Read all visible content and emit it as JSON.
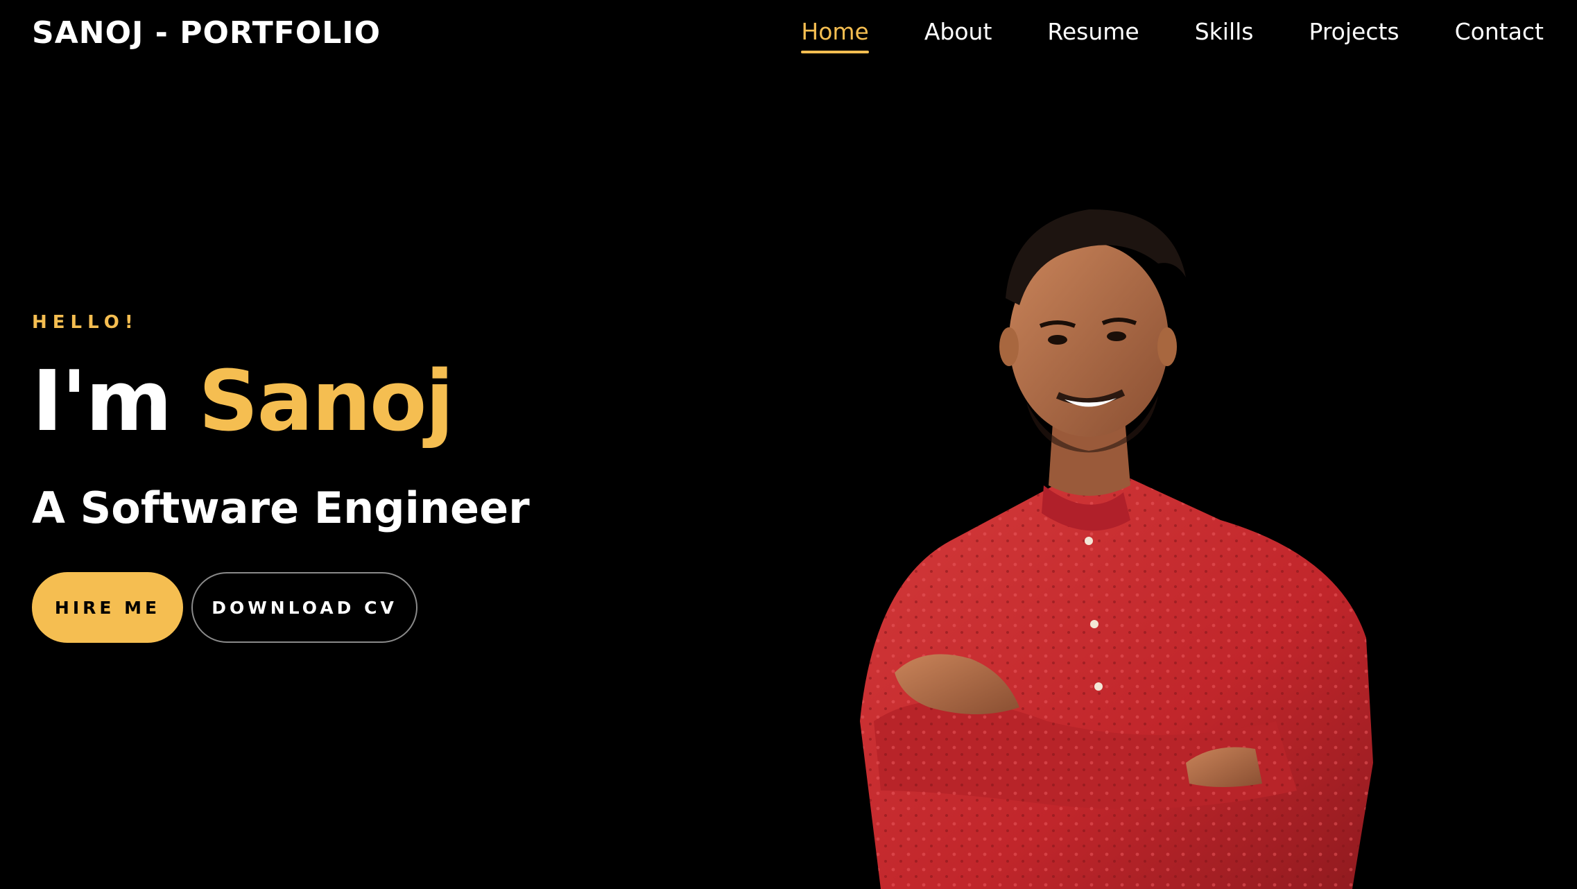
{
  "header": {
    "brand": "SANOJ - PORTFOLIO",
    "nav": [
      {
        "label": "Home",
        "active": true
      },
      {
        "label": "About",
        "active": false
      },
      {
        "label": "Resume",
        "active": false
      },
      {
        "label": "Skills",
        "active": false
      },
      {
        "label": "Projects",
        "active": false
      },
      {
        "label": "Contact",
        "active": false
      }
    ]
  },
  "hero": {
    "greeting": "HELLO!",
    "headline_prefix": "I'm",
    "headline_name": "Sanoj",
    "subtitle": "A Software Engineer",
    "primary_button": "HIRE ME",
    "secondary_button": "DOWNLOAD CV"
  },
  "colors": {
    "background": "#000000",
    "accent": "#f5be51",
    "text": "#ffffff",
    "shirt": "#c1262b"
  }
}
